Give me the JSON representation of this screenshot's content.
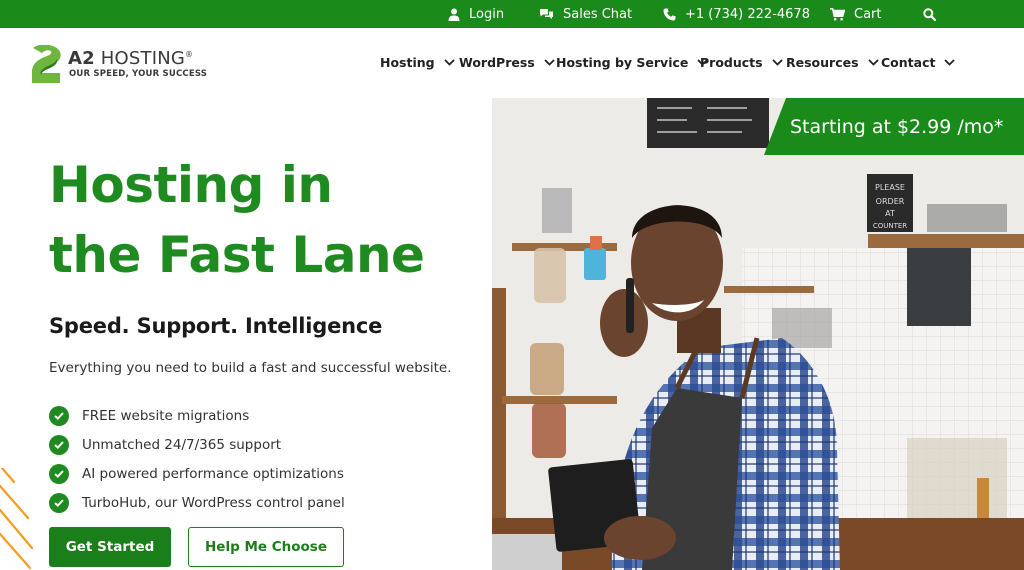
{
  "topbar": {
    "login": "Login",
    "sales_chat": "Sales Chat",
    "phone": "+1 (734) 222-4678",
    "cart": "Cart"
  },
  "logo": {
    "name_bold": "A2",
    "name_rest": "HOSTING",
    "tagline": "OUR SPEED, YOUR SUCCESS"
  },
  "nav": {
    "items": [
      {
        "label": "Hosting"
      },
      {
        "label": "WordPress"
      },
      {
        "label": "Hosting by Service"
      },
      {
        "label": "Products"
      },
      {
        "label": "Resources"
      },
      {
        "label": "Contact"
      }
    ]
  },
  "hero": {
    "title_line1": "Hosting in",
    "title_line2": "the Fast Lane",
    "subheading": "Speed. Support. Intelligence",
    "description": "Everything you need to build a fast and successful website.",
    "features": [
      "FREE website migrations",
      "Unmatched 24/7/365 support",
      "AI powered performance optimizations",
      "TurboHub, our WordPress control panel"
    ],
    "primary_button": "Get Started",
    "secondary_button": "Help Me Choose"
  },
  "promo": {
    "text": "Starting at $2.99 /mo*"
  },
  "image_signs": {
    "sign": "PLEASE ORDER AT COUNTER"
  },
  "colors": {
    "brand_green": "#1a8a1a",
    "title_green": "#1f8a1f",
    "accent_orange": "#f39c1f"
  },
  "icons": [
    "user-icon",
    "chat-icon",
    "phone-icon",
    "cart-icon",
    "search-icon",
    "chevron-down-icon",
    "check-icon"
  ]
}
